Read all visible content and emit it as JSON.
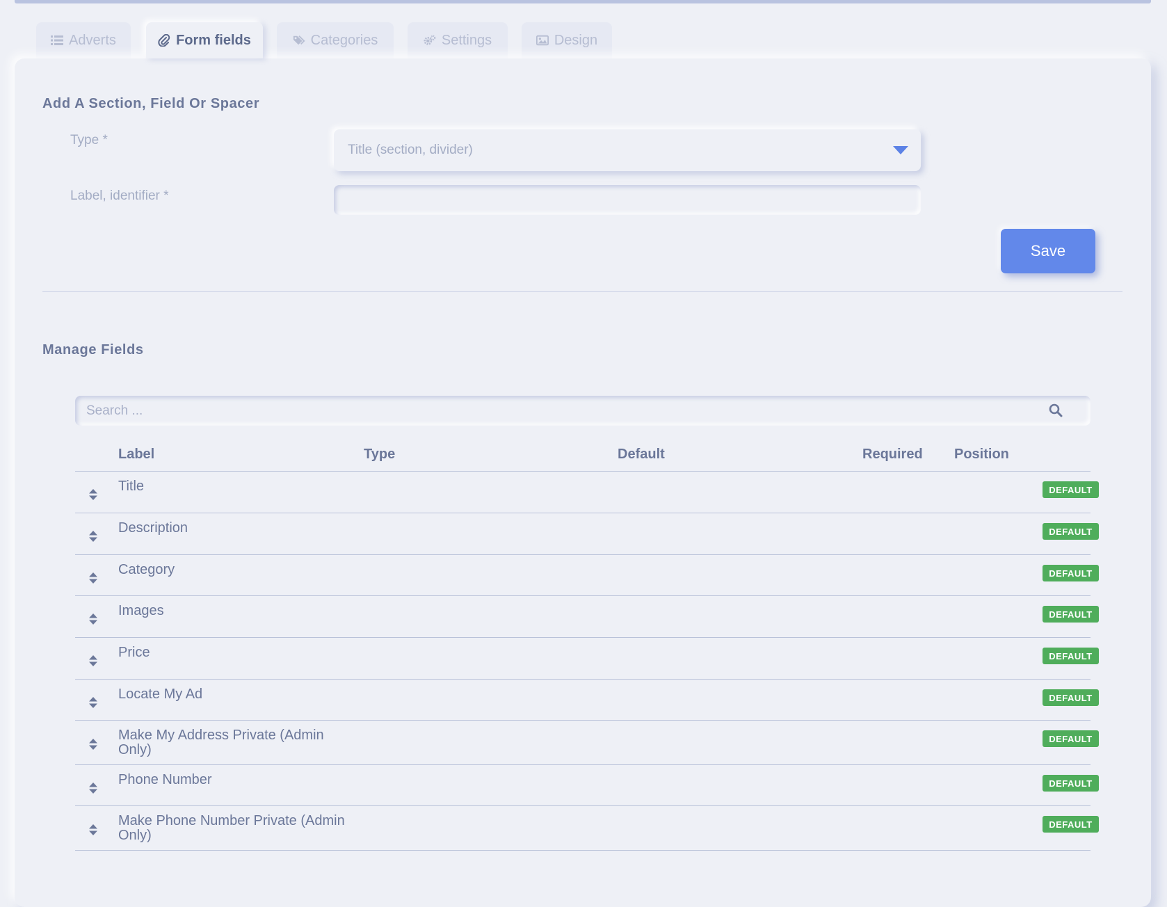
{
  "tabs": [
    {
      "label": "Adverts",
      "icon": "list-icon",
      "active": false
    },
    {
      "label": "Form fields",
      "icon": "paperclip-icon",
      "active": true
    },
    {
      "label": "Categories",
      "icon": "tags-icon",
      "active": false
    },
    {
      "label": "Settings",
      "icon": "gears-icon",
      "active": false
    },
    {
      "label": "Design",
      "icon": "image-icon",
      "active": false
    }
  ],
  "add_section": {
    "title": "Add A Section, Field Or Spacer",
    "type_label": "Type *",
    "type_value": "Title (section, divider)",
    "identifier_label": "Label, identifier *",
    "identifier_value": "",
    "save_label": "Save"
  },
  "manage": {
    "title": "Manage Fields",
    "search_placeholder": "Search ...",
    "columns": {
      "label": "Label",
      "type": "Type",
      "default": "Default",
      "required": "Required",
      "position": "Position"
    },
    "rows": [
      {
        "label": "Title",
        "badge": "DEFAULT"
      },
      {
        "label": "Description",
        "badge": "DEFAULT"
      },
      {
        "label": "Category",
        "badge": "DEFAULT"
      },
      {
        "label": "Images",
        "badge": "DEFAULT"
      },
      {
        "label": "Price",
        "badge": "DEFAULT"
      },
      {
        "label": "Locate My Ad",
        "badge": "DEFAULT"
      },
      {
        "label": "Make My Address Private (Admin Only)",
        "badge": "DEFAULT"
      },
      {
        "label": "Phone Number",
        "badge": "DEFAULT"
      },
      {
        "label": "Make Phone Number Private (Admin Only)",
        "badge": "DEFAULT"
      }
    ]
  },
  "colors": {
    "accent": "#6288ea",
    "badge": "#4fad5b",
    "background": "#eef0f6"
  }
}
